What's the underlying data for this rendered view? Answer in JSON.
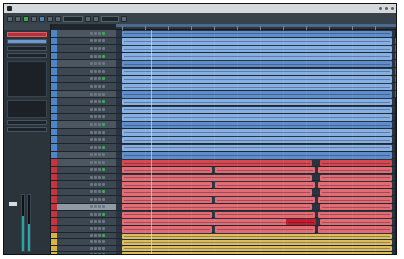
{
  "colors": {
    "window_bg": "#20262c",
    "audio_blue": "#86b0e3",
    "audio_blue_dark": "#5f8dcb",
    "midi_red": "#d7474f",
    "midi_red_light": "#e46b72",
    "fx_gold": "#dcbc5f",
    "track_blue": "#4f86c8",
    "track_red": "#c7343d",
    "track_gold": "#d8b443",
    "meter_teal": "#1fa9a8",
    "record_red": "#c9192b"
  },
  "menubar": {
    "icons": [
      "app-icon",
      "window-icon",
      "clock-icon",
      "battery-icon"
    ]
  },
  "transport": {
    "buttons": [
      "rewind-icon",
      "forward-icon",
      "play-icon",
      "stop-icon",
      "record-icon",
      "cycle-icon",
      "click-icon",
      "snap-icon",
      "grid-icon",
      "quantize-icon"
    ]
  },
  "meters": {
    "left_level": 0.62,
    "right_level": 0.48
  }
}
